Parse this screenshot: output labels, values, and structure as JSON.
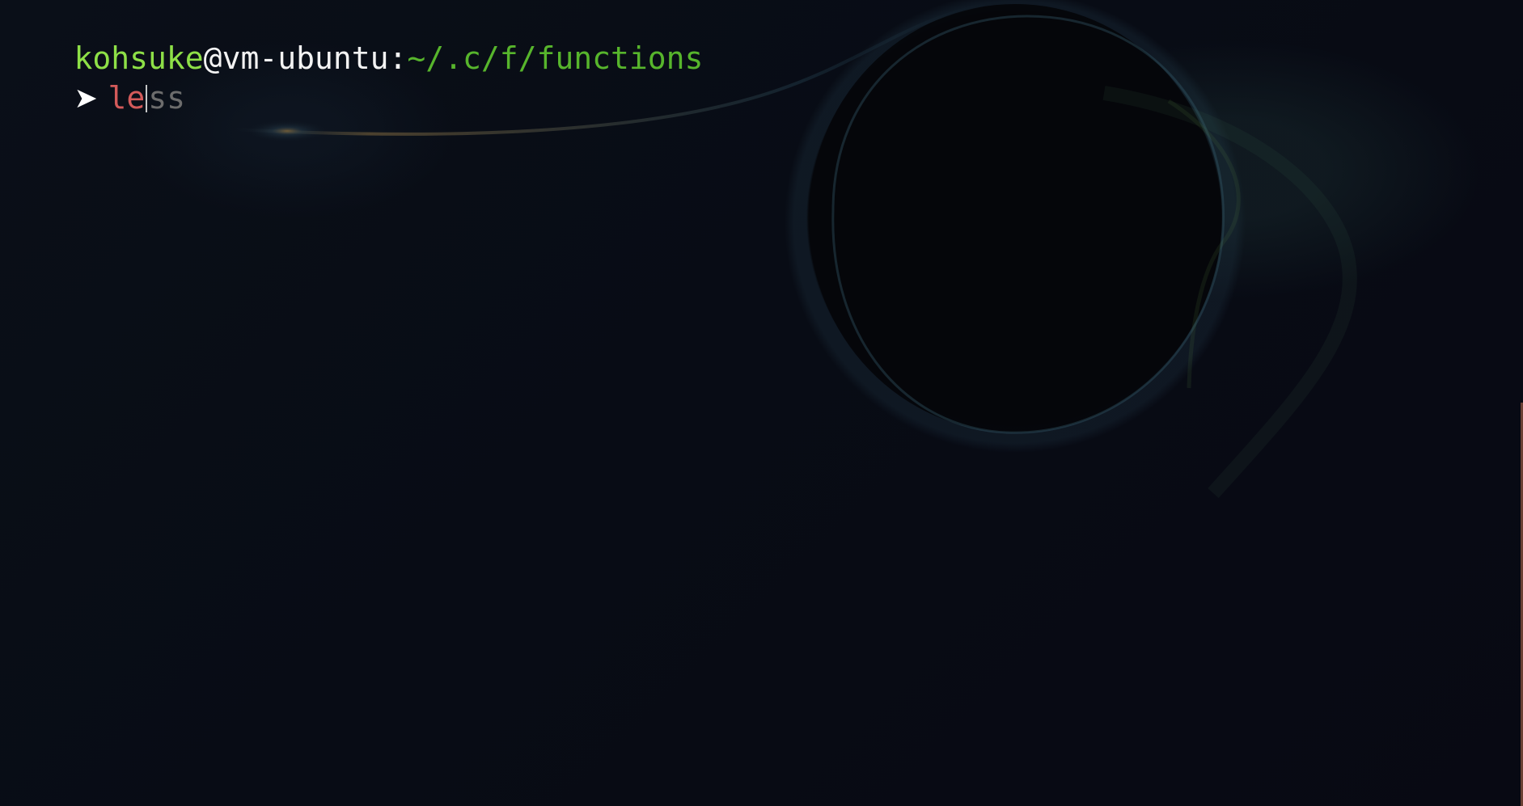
{
  "terminal": {
    "user": "kohsuke",
    "at": "@",
    "host": "vm-ubuntu",
    "colon": ":",
    "path": "~/.c/f/functions",
    "prompt_symbol": "➤",
    "typed_text": "le",
    "suggestion_text": "ss"
  },
  "colors": {
    "background": "#080b14",
    "user": "#8ee047",
    "path": "#57b52c",
    "typed": "#d45a5a",
    "suggestion": "#6c6c6c",
    "scroll_indicator": "#7b4a3a"
  },
  "icons": {
    "prompt": "arrow-prompt-icon",
    "cursor": "text-cursor"
  }
}
